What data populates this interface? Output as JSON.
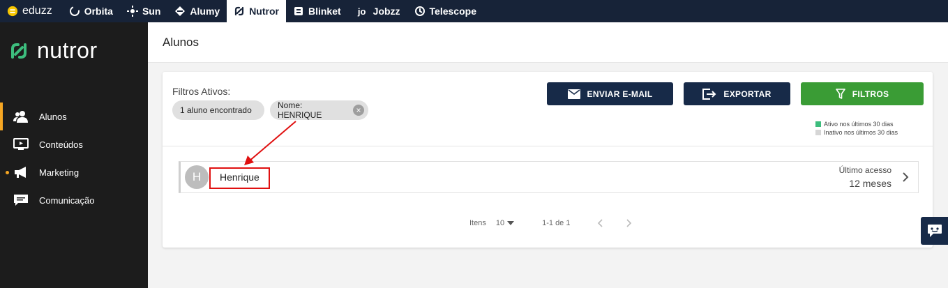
{
  "topbar": {
    "apps": [
      {
        "label": "eduzz",
        "icon": "eduzz-logo-icon"
      },
      {
        "label": "Orbita",
        "icon": "orbita-icon"
      },
      {
        "label": "Sun",
        "icon": "sun-icon"
      },
      {
        "label": "Alumy",
        "icon": "alumy-icon"
      },
      {
        "label": "Nutror",
        "icon": "nutror-icon",
        "active": true
      },
      {
        "label": "Blinket",
        "icon": "blinket-icon"
      },
      {
        "label": "Jobzz",
        "icon": "jobzz-icon"
      },
      {
        "label": "Telescope",
        "icon": "telescope-icon"
      }
    ]
  },
  "sidebar": {
    "brand": "nutror",
    "items": [
      {
        "label": "Alunos",
        "icon": "users-icon",
        "active": true
      },
      {
        "label": "Conteúdos",
        "icon": "monitor-icon"
      },
      {
        "label": "Marketing",
        "icon": "megaphone-icon",
        "notification": true
      },
      {
        "label": "Comunicação",
        "icon": "chat-icon"
      }
    ]
  },
  "page": {
    "title": "Alunos"
  },
  "filters": {
    "label": "Filtros Ativos:",
    "result_count": "1 aluno encontrado",
    "active_filter": "Nome: HENRIQUE"
  },
  "actions": {
    "email": "ENVIAR E-MAIL",
    "export": "EXPORTAR",
    "filters": "FILTROS"
  },
  "legend": {
    "active": "Ativo nos últimos 30 dias",
    "inactive": "Inativo nos últimos 30 dias",
    "active_color": "#3dbd7d",
    "inactive_color": "#d6d6d6"
  },
  "students": [
    {
      "initial": "H",
      "name": "Henrique",
      "last_access_label": "Último acesso",
      "last_access_value": "12 meses"
    }
  ],
  "pagination": {
    "items_label": "Itens",
    "per_page": "10",
    "range": "1-1 de 1"
  },
  "colors": {
    "topbar": "#172338",
    "sidebar": "#1c1c1c",
    "primary": "#172a48",
    "success": "#3a9c35",
    "accent": "#f5a623",
    "annotation": "#e01010"
  }
}
